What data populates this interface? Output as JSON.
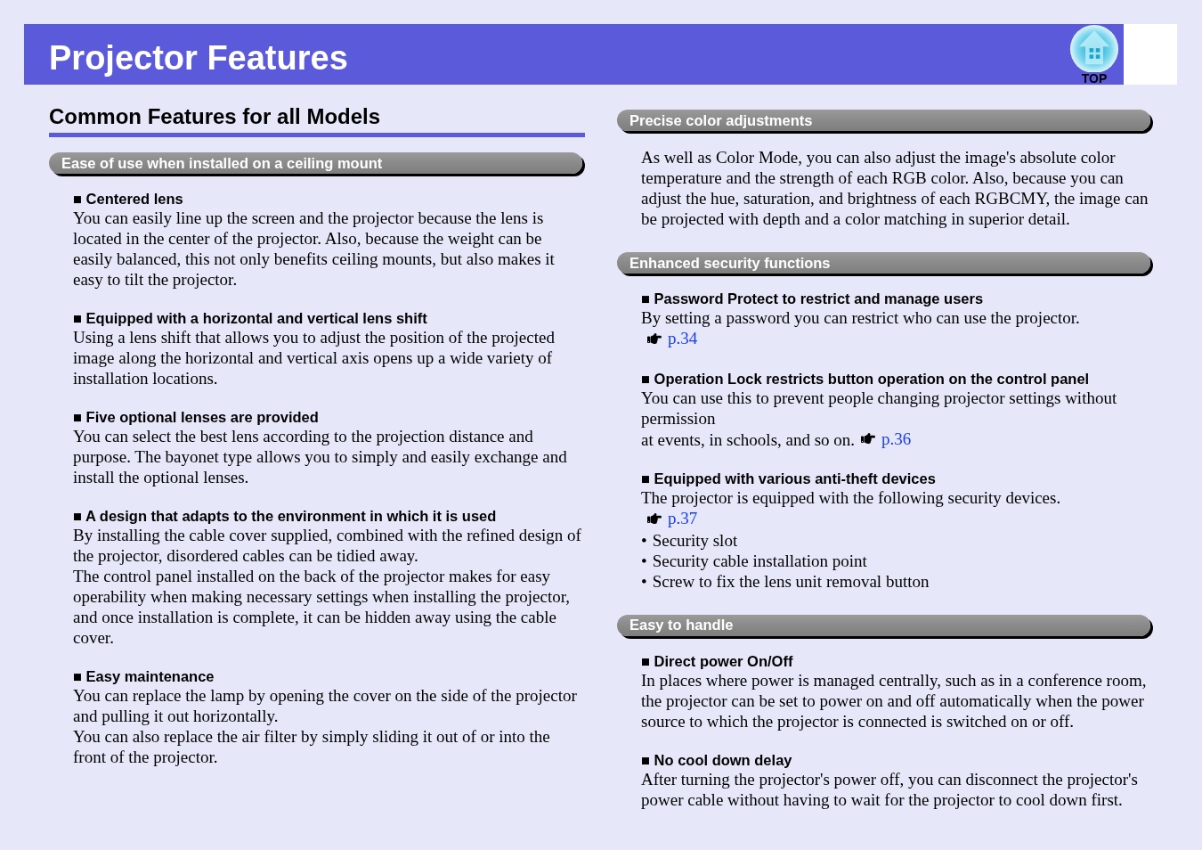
{
  "header": {
    "title": "Projector Features",
    "top_button": "TOP"
  },
  "columns": [
    {
      "heading": "Common Features for all Models",
      "sections": [
        {
          "title": "Ease of use when installed on a ceiling mount",
          "features": [
            {
              "title": "■ Centered lens",
              "body": [
                {
                  "kind": "text",
                  "text": "You can easily line up the screen and the projector because the lens is located in the center of the projector. Also, because the weight can be easily balanced, this not only benefits ceiling mounts, but also makes it easy to tilt the projector."
                }
              ]
            },
            {
              "title": "■ Equipped with a horizontal and vertical lens shift",
              "body": [
                {
                  "kind": "text",
                  "text": "Using a lens shift that allows you to adjust the position of the projected image along the horizontal and vertical axis opens up a wide variety of installation locations."
                }
              ]
            },
            {
              "title": "■ Five optional lenses are provided",
              "body": [
                {
                  "kind": "text",
                  "text": "You can select the best lens according to the projection distance and purpose. The bayonet type allows you to simply and easily exchange and install the optional lenses."
                }
              ]
            },
            {
              "title": "■ A design that adapts to the environment in which it is used",
              "body": [
                {
                  "kind": "text",
                  "text": "By installing the cable cover supplied, combined with the refined design of the projector, disordered cables can be tidied away."
                },
                {
                  "kind": "text",
                  "text": "The control panel installed on the back of the projector makes for easy operability when making necessary settings when installing the projector, and once installation is complete, it can be hidden away using the cable cover."
                }
              ]
            },
            {
              "title": "■ Easy maintenance",
              "body": [
                {
                  "kind": "text",
                  "text": "You can replace the lamp by opening the cover on the side of the projector and pulling it out horizontally."
                },
                {
                  "kind": "text",
                  "text": "You can also replace the air filter by simply sliding it out of or into the front of the projector."
                }
              ]
            }
          ]
        }
      ]
    },
    {
      "sections": [
        {
          "title": "Precise color adjustments",
          "features": [
            {
              "body": [
                {
                  "kind": "text",
                  "text": "As well as Color Mode, you can also adjust the image's absolute color temperature and the strength of each RGB color. Also, because you can adjust the hue, saturation, and brightness of each RGBCMY, the image can be projected with depth and a color matching in superior detail."
                }
              ]
            }
          ]
        },
        {
          "title": "Enhanced security functions",
          "features": [
            {
              "title": "■ Password Protect to restrict and manage users",
              "body": [
                {
                  "kind": "text",
                  "text": "By setting a password you can restrict who can use the projector."
                },
                {
                  "kind": "link",
                  "link": "p.34"
                }
              ]
            },
            {
              "title": "■ Operation Lock restricts button operation on the control panel",
              "body": [
                {
                  "kind": "text",
                  "text": "You can use this to prevent people changing projector settings without permission"
                },
                {
                  "kind": "text",
                  "text": "at events, in schools, and so on.",
                  "link": "p.36"
                }
              ]
            },
            {
              "title": "■ Equipped with various anti-theft devices",
              "body": [
                {
                  "kind": "text",
                  "text": "The projector is equipped with the following security devices."
                },
                {
                  "kind": "link",
                  "link": "p.37"
                },
                {
                  "kind": "bullet",
                  "marker": "•",
                  "text": "Security slot"
                },
                {
                  "kind": "bullet",
                  "marker": "•",
                  "text": "Security cable installation point"
                },
                {
                  "kind": "bullet",
                  "marker": "•",
                  "text": "Screw to fix the lens unit removal button"
                }
              ]
            }
          ]
        },
        {
          "title": "Easy to handle",
          "features": [
            {
              "title": "■ Direct power On/Off",
              "body": [
                {
                  "kind": "text",
                  "text": "In places where power is managed centrally, such as in a conference room,"
                },
                {
                  "kind": "text",
                  "text": "the projector can be set to power on and off automatically when the power source to which the projector is connected is switched on or off."
                }
              ]
            },
            {
              "title": "■ No cool down delay",
              "body": [
                {
                  "kind": "text",
                  "text": "After turning the projector's power off, you can disconnect the projector's power cable without having to wait for the projector to cool down first."
                }
              ]
            }
          ]
        }
      ]
    }
  ]
}
